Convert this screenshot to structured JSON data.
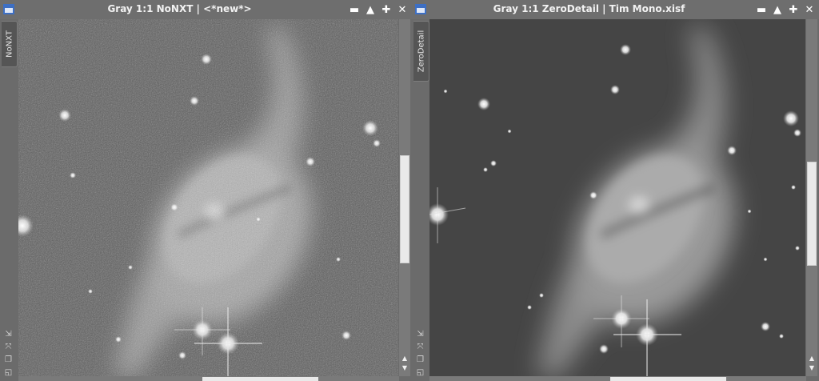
{
  "windows": [
    {
      "title": "Gray 1:1 NoNXT | <*new*>",
      "side_tab": "NoNXT",
      "buttons": {
        "shade": "▬",
        "maximize": "▲",
        "expand": "✚",
        "close": "✕"
      }
    },
    {
      "title": "Gray 1:1 ZeroDetail | Tim Mono.xisf",
      "side_tab": "ZeroDetail",
      "buttons": {
        "shade": "▬",
        "maximize": "▲",
        "expand": "✚",
        "close": "✕"
      }
    }
  ],
  "icons": {
    "window": "window-icon",
    "side": [
      "fit-view-icon",
      "zoom-icon",
      "clone-icon",
      "info-icon"
    ],
    "scroll_up": "▲",
    "scroll_down": "▼"
  },
  "colors": {
    "title_bar": "#6e6e6e",
    "window_icon": "#3d6fc4",
    "scroll_thumb": "#e9e9e9"
  }
}
